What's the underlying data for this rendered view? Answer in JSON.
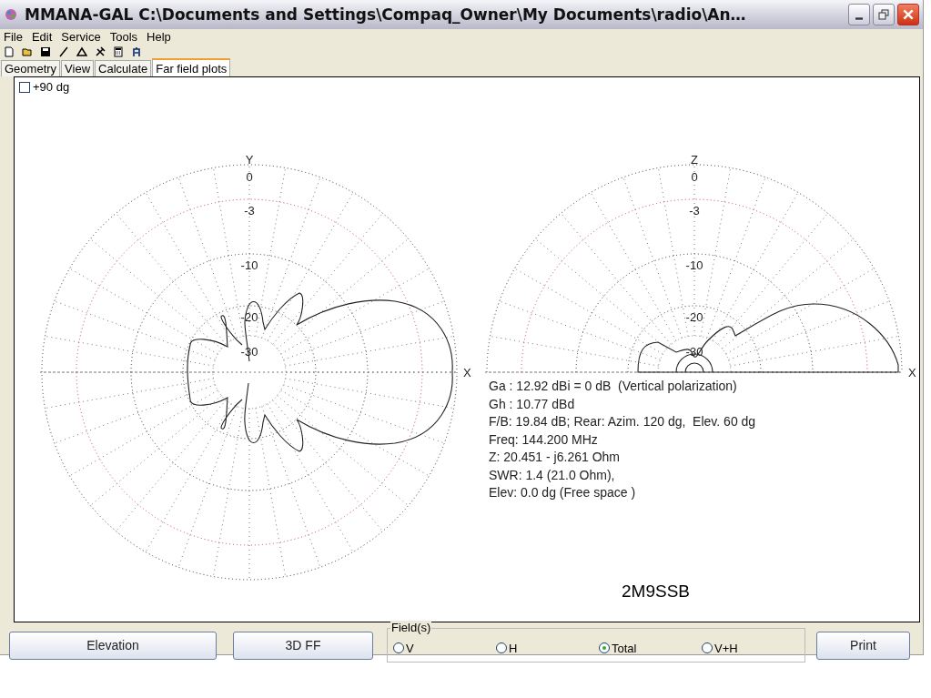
{
  "window": {
    "title": "MMANA-GAL C:\\Documents and Settings\\Compaq_Owner\\My Documents\\radio\\An…"
  },
  "menu": [
    "File",
    "Edit",
    "Service",
    "Tools",
    "Help"
  ],
  "tabs": [
    {
      "label": "Geometry",
      "selected": false
    },
    {
      "label": "View",
      "selected": false
    },
    {
      "label": "Calculate",
      "selected": false
    },
    {
      "label": "Far field plots",
      "selected": true
    }
  ],
  "options": {
    "label": "+90 dg",
    "checked": false
  },
  "plots": [
    {
      "kind": "full",
      "axis_top": "Y",
      "axis_right": "X",
      "ring_labels": [
        "0",
        "-3",
        "-10",
        "-20",
        "-30"
      ]
    },
    {
      "kind": "half",
      "axis_top": "Z",
      "axis_right": "X",
      "ring_labels": [
        "0",
        "-3",
        "-10",
        "-20",
        "-30"
      ]
    }
  ],
  "info": [
    "Ga : 12.92 dBi = 0 dB  (Vertical polarization)",
    "Gh : 10.77 dBd",
    "F/B: 19.84 dB; Rear: Azim. 120 dg,  Elev. 60 dg",
    "Freq: 144.200 MHz",
    "Z: 20.451 - j6.261 Ohm",
    "SWR: 1.4 (21.0 Ohm),",
    "Elev: 0.0 dg (Free space )"
  ],
  "antenna_name": "2M9SSB",
  "buttons": {
    "elevation": "Elevation",
    "ff3d": "3D FF",
    "print": "Print"
  },
  "fields": {
    "legend": "Field(s)",
    "options": [
      {
        "label": "V",
        "selected": false
      },
      {
        "label": "H",
        "selected": false
      },
      {
        "label": "Total",
        "selected": true
      },
      {
        "label": "V+H",
        "selected": false
      }
    ]
  }
}
